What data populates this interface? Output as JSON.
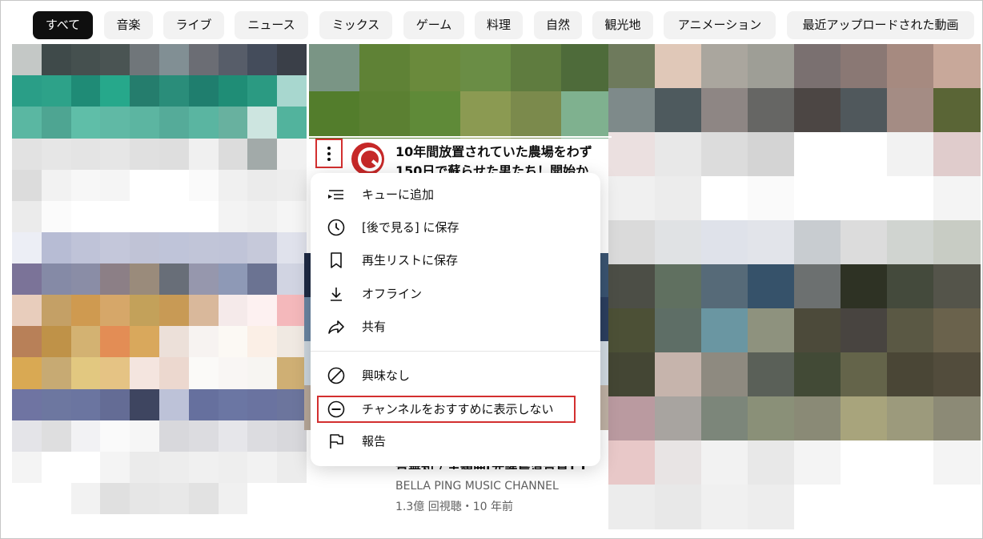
{
  "chips": [
    {
      "label": "すべて",
      "active": true
    },
    {
      "label": "音楽"
    },
    {
      "label": "ライブ"
    },
    {
      "label": "ニュース"
    },
    {
      "label": "ミックス"
    },
    {
      "label": "ゲーム"
    },
    {
      "label": "料理"
    },
    {
      "label": "自然"
    },
    {
      "label": "観光地"
    },
    {
      "label": "アニメーション"
    },
    {
      "label": "最近アップロードされた動画"
    }
  ],
  "video": {
    "title_line1": "10年間放置されていた農場をわず",
    "title_line2": "150日で蘇らせた男たち！開始か"
  },
  "bottom_video": {
    "title": "音無知 / 主題曲[光謡島清音質] T",
    "channel": "BELLA PING MUSIC CHANNEL",
    "meta": "1.3億 回視聴・10 年前"
  },
  "menu": {
    "items": [
      {
        "label": "キューに追加",
        "icon": "add-to-queue-icon"
      },
      {
        "label": "[後で見る] に保存",
        "icon": "clock-icon"
      },
      {
        "label": "再生リストに保存",
        "icon": "bookmark-icon"
      },
      {
        "label": "オフライン",
        "icon": "download-icon"
      },
      {
        "label": "共有",
        "icon": "share-icon"
      },
      {
        "label": "興味なし",
        "icon": "not-interested-icon"
      },
      {
        "label": "チャンネルをおすすめに表示しない",
        "icon": "minus-circle-icon"
      },
      {
        "label": "報告",
        "icon": "flag-icon"
      }
    ]
  },
  "colors": {
    "highlight": "#d32f2f",
    "active_chip_bg": "#0f0f0f",
    "chip_bg": "#f2f2f2"
  }
}
